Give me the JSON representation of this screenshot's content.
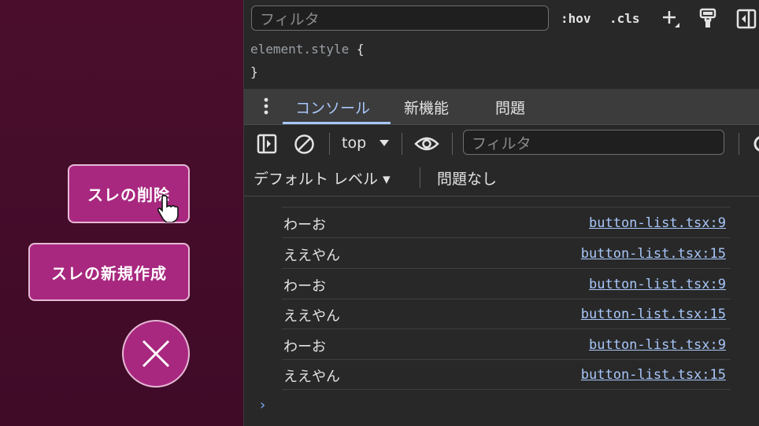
{
  "app": {
    "delete_label": "スレの削除",
    "new_label": "スレの新規作成"
  },
  "styles_pane": {
    "filter_placeholder": "フィルタ",
    "hov": ":hov",
    "cls": ".cls",
    "selector": "element.style",
    "open_brace": "{",
    "close_brace": "}"
  },
  "tabs": {
    "console": "コンソール",
    "whats_new": "新機能",
    "issues": "問題"
  },
  "console_toolbar": {
    "context": "top",
    "filter_placeholder": "フィルタ",
    "levels": "デフォルト レベル ▾",
    "issues_status": "問題なし"
  },
  "logs": [
    {
      "message": "わーお",
      "source": "button-list.tsx:9"
    },
    {
      "message": "ええやん",
      "source": "button-list.tsx:15"
    },
    {
      "message": "わーお",
      "source": "button-list.tsx:9"
    },
    {
      "message": "ええやん",
      "source": "button-list.tsx:15"
    },
    {
      "message": "わーお",
      "source": "button-list.tsx:9"
    },
    {
      "message": "ええやん",
      "source": "button-list.tsx:15"
    }
  ],
  "prompt_symbol": "›",
  "colors": {
    "accent_pink": "#a8287f",
    "app_bg": "#4a0e2c",
    "devtools_bg": "#282828",
    "link_blue": "#a8c7fa"
  }
}
